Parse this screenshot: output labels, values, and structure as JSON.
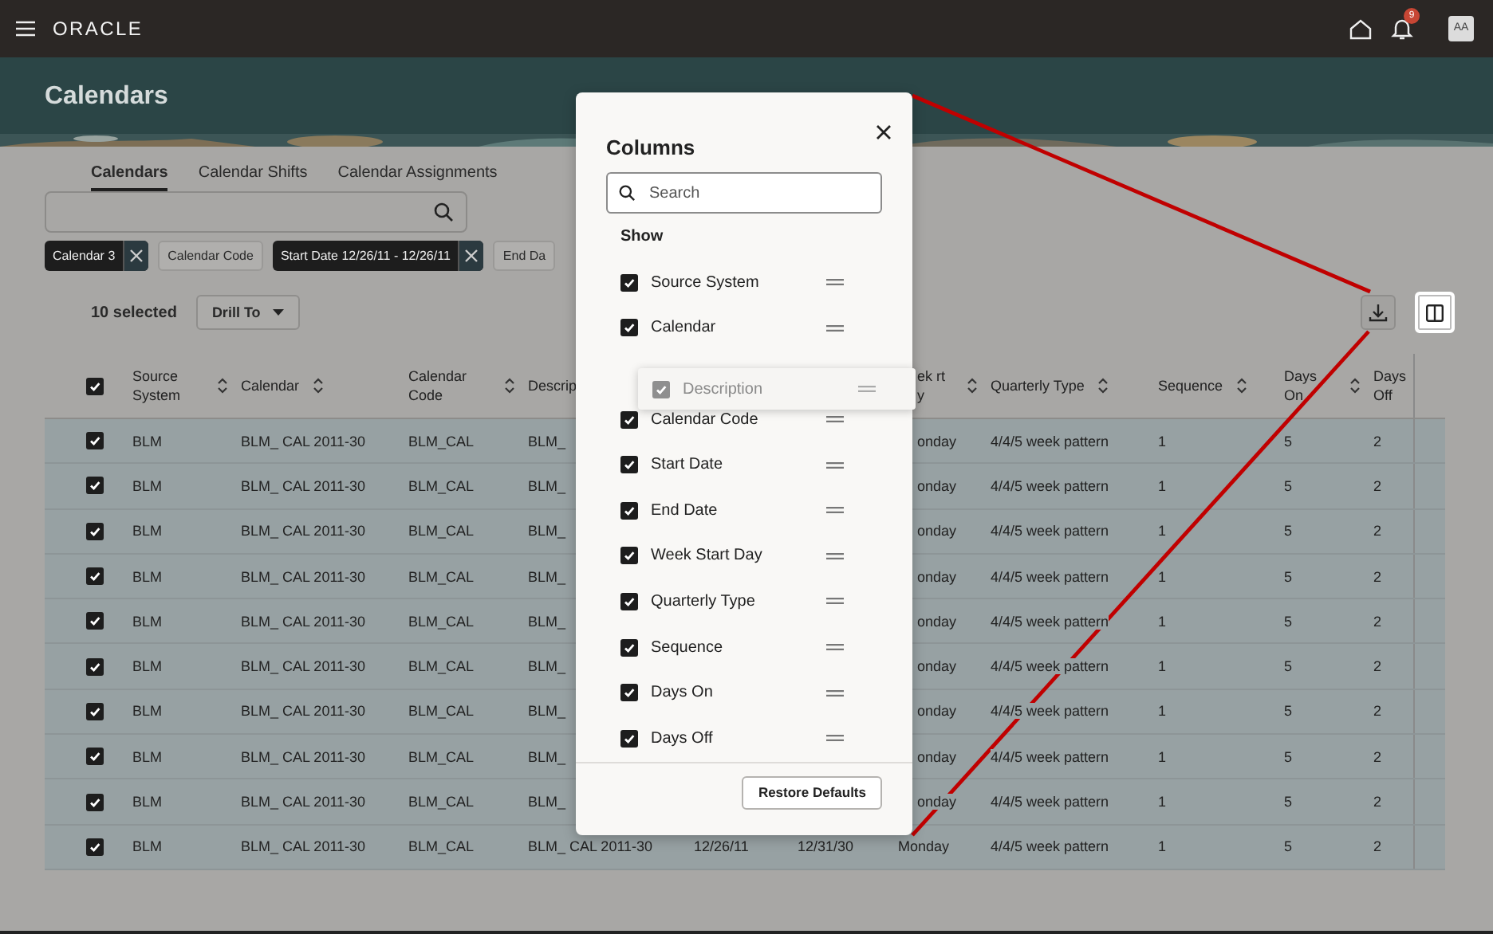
{
  "top_bar": {
    "logo": "ORACLE",
    "notification_count": "9",
    "avatar": "AA"
  },
  "page": {
    "title": "Calendars"
  },
  "tabs": [
    {
      "label": "Calendars",
      "selected": true
    },
    {
      "label": "Calendar Shifts",
      "selected": false
    },
    {
      "label": "Calendar Assignments",
      "selected": false
    }
  ],
  "filter_chips": [
    {
      "label": "Calendar 3",
      "kind": "applied"
    },
    {
      "label": "Calendar Code",
      "kind": "suggested"
    },
    {
      "label": "Start Date 12/26/11 - 12/26/11",
      "kind": "applied"
    },
    {
      "label": "End Da",
      "kind": "suggested"
    }
  ],
  "toolbar": {
    "selection_count": "10 selected",
    "drill_button": "Drill To"
  },
  "table": {
    "header_checked": true,
    "columns": [
      {
        "label": "Source System",
        "sortable": true
      },
      {
        "label": "Calendar",
        "sortable": true
      },
      {
        "label": "Calendar Code",
        "sortable": true
      },
      {
        "label": "Descrip",
        "sortable": false
      },
      null,
      null,
      {
        "label": "ek rt y",
        "sortable": true
      },
      {
        "label": "Quarterly Type",
        "sortable": true
      },
      {
        "label": "Sequence",
        "sortable": true
      },
      {
        "label": "Days On",
        "sortable": true
      },
      {
        "label": "Days Off",
        "sortable": false
      }
    ],
    "rows": [
      {
        "selected": true,
        "cells": [
          "BLM",
          "BLM_ CAL 2011-30",
          "BLM_CAL",
          "BLM_",
          null,
          null,
          "onday",
          "4/4/5 week pattern",
          "1",
          "5",
          "2"
        ]
      },
      {
        "selected": true,
        "cells": [
          "BLM",
          "BLM_ CAL 2011-30",
          "BLM_CAL",
          "BLM_",
          null,
          null,
          "onday",
          "4/4/5 week pattern",
          "1",
          "5",
          "2"
        ]
      },
      {
        "selected": true,
        "cells": [
          "BLM",
          "BLM_ CAL 2011-30",
          "BLM_CAL",
          "BLM_",
          null,
          null,
          "onday",
          "4/4/5 week pattern",
          "1",
          "5",
          "2"
        ]
      },
      {
        "selected": true,
        "cells": [
          "BLM",
          "BLM_ CAL 2011-30",
          "BLM_CAL",
          "BLM_",
          null,
          null,
          "onday",
          "4/4/5 week pattern",
          "1",
          "5",
          "2"
        ]
      },
      {
        "selected": true,
        "cells": [
          "BLM",
          "BLM_ CAL 2011-30",
          "BLM_CAL",
          "BLM_",
          null,
          null,
          "onday",
          "4/4/5 week pattern",
          "1",
          "5",
          "2"
        ]
      },
      {
        "selected": true,
        "cells": [
          "BLM",
          "BLM_ CAL 2011-30",
          "BLM_CAL",
          "BLM_",
          null,
          null,
          "onday",
          "4/4/5 week pattern",
          "1",
          "5",
          "2"
        ]
      },
      {
        "selected": true,
        "cells": [
          "BLM",
          "BLM_ CAL 2011-30",
          "BLM_CAL",
          "BLM_",
          null,
          null,
          "onday",
          "4/4/5 week pattern",
          "1",
          "5",
          "2"
        ]
      },
      {
        "selected": true,
        "cells": [
          "BLM",
          "BLM_ CAL 2011-30",
          "BLM_CAL",
          "BLM_",
          null,
          null,
          "onday",
          "4/4/5 week pattern",
          "1",
          "5",
          "2"
        ]
      },
      {
        "selected": true,
        "cells": [
          "BLM",
          "BLM_ CAL 2011-30",
          "BLM_CAL",
          "BLM_",
          null,
          null,
          "onday",
          "4/4/5 week pattern",
          "1",
          "5",
          "2"
        ]
      },
      {
        "selected": true,
        "cells": [
          "BLM",
          "BLM_ CAL 2011-30",
          "BLM_CAL",
          "BLM_ CAL 2011-30",
          "12/26/11",
          "12/31/30",
          "Monday",
          "4/4/5 week pattern",
          "1",
          "5",
          "2"
        ]
      }
    ]
  },
  "columns_dialog": {
    "title": "Columns",
    "search_placeholder": "Search",
    "section": "Show",
    "items": [
      {
        "label": "Source System",
        "checked": true,
        "kind": "item"
      },
      {
        "label": "Calendar",
        "checked": true,
        "kind": "item"
      },
      {
        "label": "Description",
        "checked": true,
        "kind": "dragging"
      },
      {
        "label": "Calendar Code",
        "checked": true,
        "kind": "item"
      },
      {
        "label": "Start Date",
        "checked": true,
        "kind": "item"
      },
      {
        "label": "End Date",
        "checked": true,
        "kind": "item"
      },
      {
        "label": "Week Start Day",
        "checked": true,
        "kind": "item"
      },
      {
        "label": "Quarterly Type",
        "checked": true,
        "kind": "item"
      },
      {
        "label": "Sequence",
        "checked": true,
        "kind": "item"
      },
      {
        "label": "Days On",
        "checked": true,
        "kind": "item"
      },
      {
        "label": "Days Off",
        "checked": true,
        "kind": "item"
      }
    ],
    "restore_button": "Restore Defaults"
  }
}
